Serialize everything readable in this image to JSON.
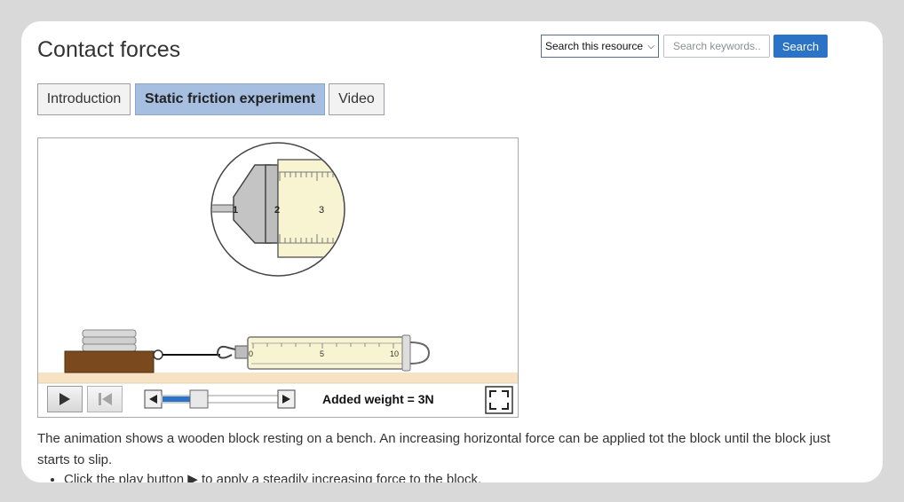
{
  "page": {
    "title": "Contact forces"
  },
  "search": {
    "scope_value": "Search this resource",
    "placeholder": "Search keywords..",
    "button_label": "Search"
  },
  "tabs": [
    {
      "label": "Introduction",
      "active": false
    },
    {
      "label": "Static friction experiment",
      "active": true
    },
    {
      "label": "Video",
      "active": false
    }
  ],
  "animation": {
    "magnifier_ticks": [
      "1",
      "2",
      "3"
    ],
    "scale_ticks": [
      "0",
      "5",
      "10"
    ],
    "added_weight_label": "Added weight = 3N",
    "slider_fraction": 0.3
  },
  "description": {
    "text": "The animation shows a wooden block resting on a bench. An increasing horizontal force can be applied tot the block until the block just starts to slip.",
    "bullets": [
      "Click the play button ▶ to apply a steadily increasing force to the block."
    ]
  },
  "colors": {
    "accent": "#2b73c6",
    "active_tab": "#a6bfe0",
    "wood": "#7a4a1e",
    "bench": "#f7e2c4",
    "spring_scale": "#f8f4d2"
  }
}
